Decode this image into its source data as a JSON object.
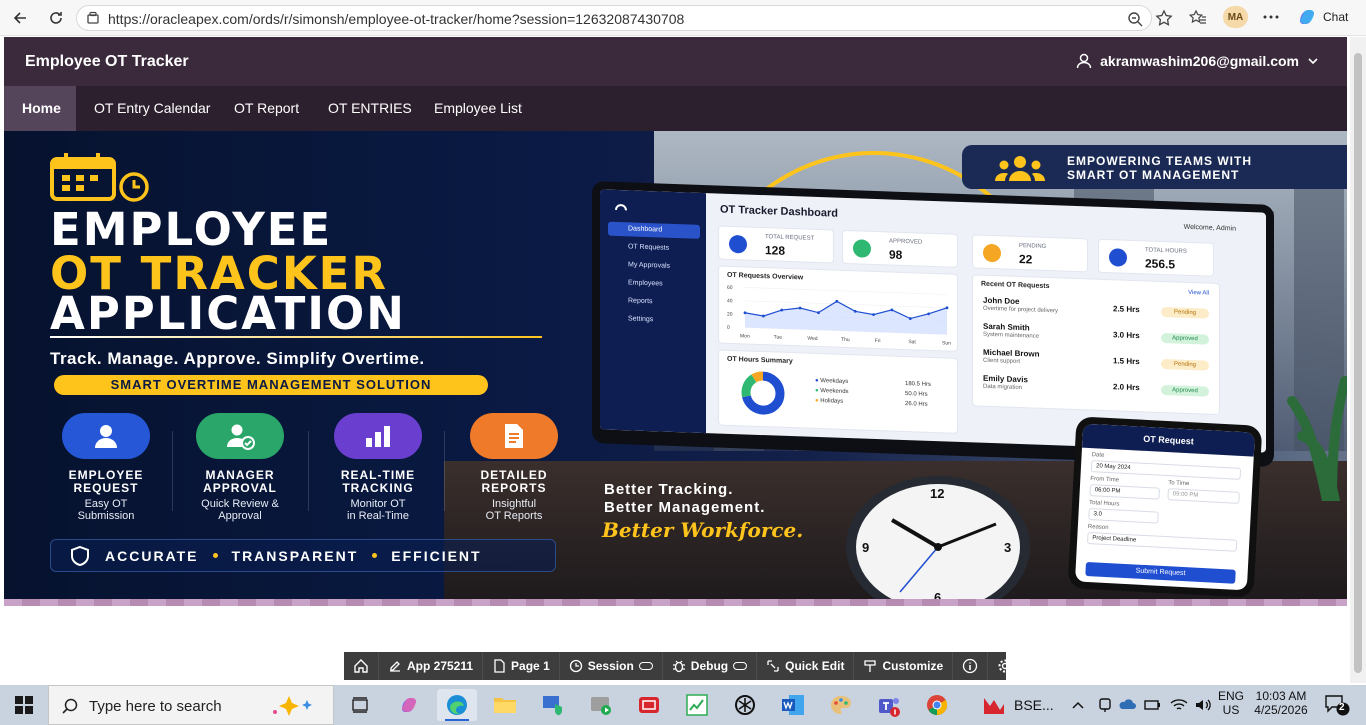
{
  "browser": {
    "url": "https://oracleapex.com/ords/r/simonsh/employee-ot-tracker/home?session=12632087430708",
    "profile_initials": "MA",
    "chat_label": "Chat"
  },
  "app": {
    "title": "Employee OT Tracker",
    "user": "akramwashim206@gmail.com",
    "nav": [
      "Home",
      "OT Entry Calendar",
      "OT Report",
      "OT ENTRIES",
      "Employee List"
    ]
  },
  "hero": {
    "title_line1": "EMPLOYEE",
    "title_line2": "OT TRACKER",
    "title_line3": "APPLICATION",
    "tagline": "Track. Manage. Approve. Simplify Overtime.",
    "pill": "SMART OVERTIME MANAGEMENT SOLUTION",
    "features": [
      {
        "title1": "EMPLOYEE",
        "title2": "REQUEST",
        "sub1": "Easy OT",
        "sub2": "Submission"
      },
      {
        "title1": "MANAGER",
        "title2": "APPROVAL",
        "sub1": "Quick Review &",
        "sub2": "Approval"
      },
      {
        "title1": "REAL-TIME",
        "title2": "TRACKING",
        "sub1": "Monitor OT",
        "sub2": "in Real-Time"
      },
      {
        "title1": "DETAILED",
        "title2": "REPORTS",
        "sub1": "Insightful",
        "sub2": "OT Reports"
      }
    ],
    "footer": [
      "ACCURATE",
      "TRANSPARENT",
      "EFFICIENT"
    ],
    "badge_line1": "EMPOWERING TEAMS WITH",
    "badge_line2": "SMART OT MANAGEMENT",
    "better1": "Better Tracking.",
    "better2": "Better Management.",
    "better3": "Better Workforce."
  },
  "dashboard": {
    "title": "OT Tracker Dashboard",
    "welcome": "Welcome, Admin",
    "sidebar": [
      "Dashboard",
      "OT Requests",
      "My Approvals",
      "Employees",
      "Reports",
      "Settings"
    ],
    "stats": [
      {
        "label": "TOTAL REQUEST",
        "value": "128"
      },
      {
        "label": "APPROVED",
        "value": "98"
      },
      {
        "label": "PENDING",
        "value": "22"
      },
      {
        "label": "TOTAL HOURS",
        "value": "256.5"
      }
    ],
    "overview_title": "OT Requests Overview",
    "overview_days": [
      "Mon",
      "Tue",
      "Wed",
      "Thu",
      "Fri",
      "Sat",
      "Sun"
    ],
    "overview_ticks": [
      "60",
      "40",
      "20",
      "0"
    ],
    "overview_values": [
      22,
      18,
      28,
      32,
      26,
      44,
      30,
      26,
      34,
      22,
      30,
      40
    ],
    "summary_title": "OT Hours Summary",
    "summary": [
      {
        "label": "Weekdays",
        "value": "180.5 Hrs",
        "color": "#1f4ed1"
      },
      {
        "label": "Weekends",
        "value": "50.0 Hrs",
        "color": "#2eb872"
      },
      {
        "label": "Holidays",
        "value": "26.0 Hrs",
        "color": "#f5a623"
      }
    ],
    "recent_title": "Recent OT Requests",
    "view_all": "View All",
    "recent": [
      {
        "name": "John Doe",
        "desc": "Overtime for project delivery",
        "hrs": "2.5 Hrs",
        "status": "Pending"
      },
      {
        "name": "Sarah Smith",
        "desc": "System maintenance",
        "hrs": "3.0 Hrs",
        "status": "Approved"
      },
      {
        "name": "Michael Brown",
        "desc": "Client support",
        "hrs": "1.5 Hrs",
        "status": "Pending"
      },
      {
        "name": "Emily Davis",
        "desc": "Data migration",
        "hrs": "2.0 Hrs",
        "status": "Approved"
      }
    ]
  },
  "phone": {
    "title": "OT Request",
    "date_label": "Date",
    "date_value": "20 May 2024",
    "from_label": "From Time",
    "from_value": "06:00 PM",
    "to_label": "To Time",
    "to_value": "09:00 PM",
    "total_label": "Total Hours",
    "total_value": "3.0",
    "reason_label": "Reason",
    "reason_value": "Project Deadline",
    "submit": "Submit Request"
  },
  "clock_numbers": [
    "12",
    "3",
    "6",
    "9"
  ],
  "dev_toolbar": {
    "app": "App 275211",
    "page": "Page 1",
    "session": "Session",
    "debug": "Debug",
    "quick_edit": "Quick Edit",
    "customize": "Customize"
  },
  "taskbar": {
    "search_placeholder": "Type here to search",
    "bse_label": "BSE...",
    "lang1": "ENG",
    "lang2": "US",
    "time": "10:03 AM",
    "date": "4/25/2026",
    "notif_count": "2"
  }
}
